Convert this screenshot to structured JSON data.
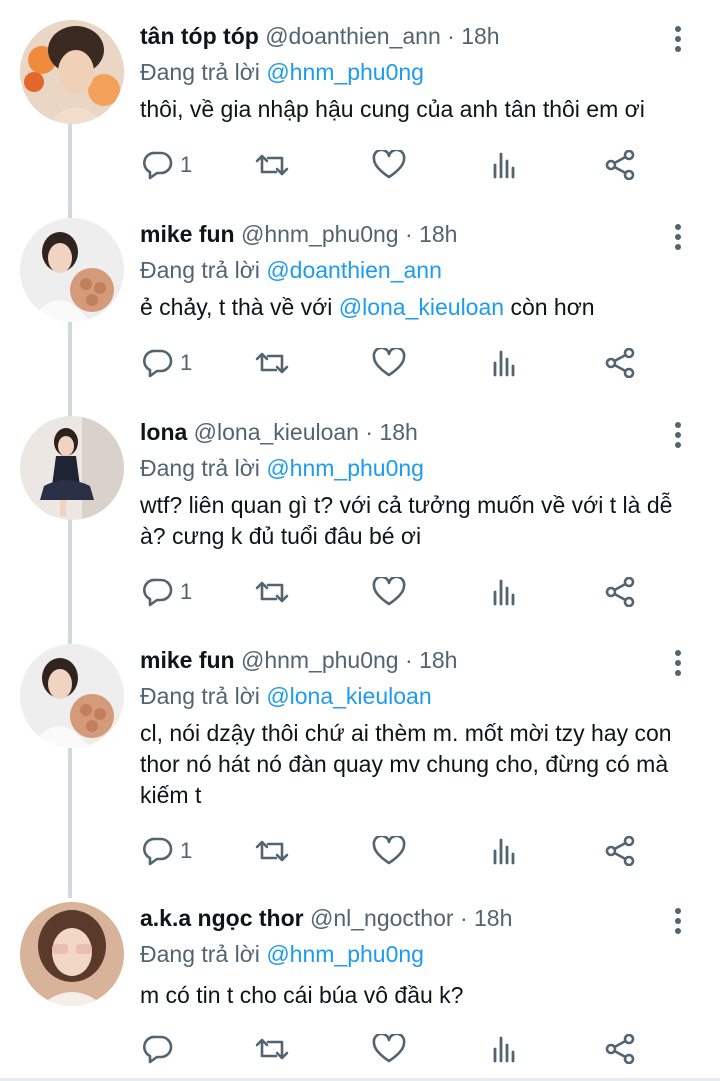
{
  "tweets": [
    {
      "name": "tân tóp tóp",
      "handle": "@doanthien_ann",
      "separator": "·",
      "time": "18h",
      "reply_prefix": "Đang trả lời ",
      "reply_to": "@hnm_phu0ng",
      "text_parts": [
        "thôi, về gia nhập hậu cung của anh tân thôi em ơi"
      ],
      "reply_count": "1"
    },
    {
      "name": "mike fun",
      "handle": "@hnm_phu0ng",
      "separator": "·",
      "time": "18h",
      "reply_prefix": "Đang trả lời ",
      "reply_to": "@doanthien_ann",
      "text_parts": [
        "ẻ chảy, t thà về với ",
        "@lona_kieuloan",
        " còn hơn"
      ],
      "reply_count": "1"
    },
    {
      "name": "lona",
      "handle": "@lona_kieuloan",
      "separator": "·",
      "time": "18h",
      "reply_prefix": "Đang trả lời ",
      "reply_to": "@hnm_phu0ng",
      "text_parts": [
        "wtf? liên quan gì t? với cả tưởng muốn về với t là dễ à? cưng k đủ tuổi đâu bé ơi"
      ],
      "reply_count": "1"
    },
    {
      "name": "mike fun",
      "handle": "@hnm_phu0ng",
      "separator": "·",
      "time": "18h",
      "reply_prefix": "Đang trả lời ",
      "reply_to": "@lona_kieuloan",
      "text_parts": [
        "cl, nói dzậy thôi chứ ai thèm m. mốt mời tzy hay con thor nó hát nó đàn quay mv chung cho, đừng có mà kiếm t"
      ],
      "reply_count": "1"
    },
    {
      "name": "a.k.a ngọc thor",
      "handle": "@nl_ngocthor",
      "separator": "·",
      "time": "18h",
      "reply_prefix": "Đang trả lời ",
      "reply_to": "@hnm_phu0ng",
      "text_parts": [
        "m có tin t cho cái búa vô đầu k?"
      ],
      "reply_count": ""
    }
  ],
  "icons": {
    "reply": "reply-icon",
    "retweet": "retweet-icon",
    "like": "like-icon",
    "views": "views-icon",
    "share": "share-icon",
    "more": "more-vertical-icon"
  },
  "colors": {
    "text": "#0f1419",
    "secondary": "#536471",
    "mention": "#1d9bf0",
    "thread_line": "#cfd9de"
  }
}
